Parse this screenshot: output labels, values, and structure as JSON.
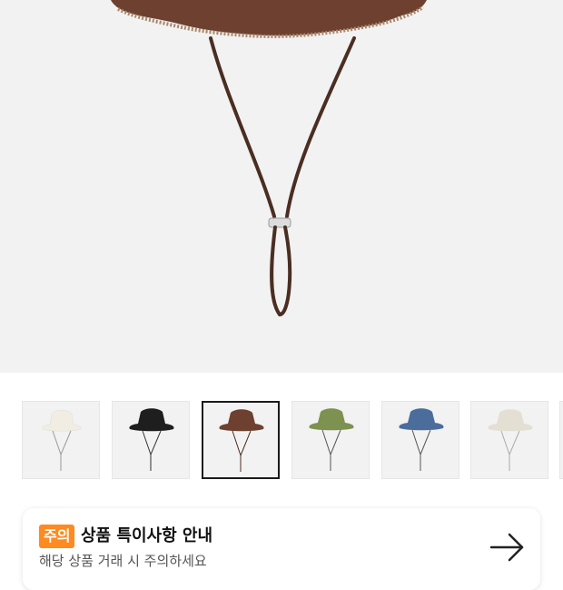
{
  "product": {
    "main_image": "brown-bucket-hat-with-chin-strap",
    "selected_color": "brown"
  },
  "thumbnails": [
    {
      "color_name": "cream",
      "hat_color": "#f1ede3"
    },
    {
      "color_name": "black",
      "hat_color": "#1e1e1e"
    },
    {
      "color_name": "brown",
      "hat_color": "#6e4030"
    },
    {
      "color_name": "khaki",
      "hat_color": "#7d9150"
    },
    {
      "color_name": "blue",
      "hat_color": "#4a6d9c"
    },
    {
      "color_name": "beige",
      "hat_color": "#e4dfd3"
    }
  ],
  "notice": {
    "badge": "주의",
    "title": "상품 특이사항 안내",
    "subtitle": "해당 상품 거래 시 주의하세요",
    "arrow_icon": "arrow-right-icon",
    "badge_color": "#ff8a1f"
  }
}
